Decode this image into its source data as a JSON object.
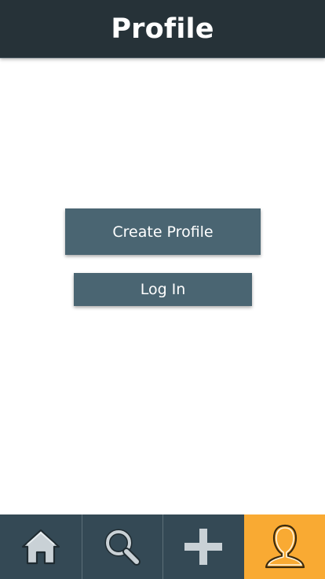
{
  "header": {
    "title": "Profile"
  },
  "actions": {
    "create_profile_label": "Create Profile",
    "log_in_label": "Log In"
  },
  "tabbar": {
    "items": [
      {
        "icon": "home-icon",
        "active": false
      },
      {
        "icon": "search-icon",
        "active": false
      },
      {
        "icon": "plus-icon",
        "active": false
      },
      {
        "icon": "user-icon",
        "active": true
      }
    ]
  },
  "colors": {
    "header_bg": "#263238",
    "button_bg": "#4a6572",
    "tabbar_bg": "#344955",
    "active_tab": "#f9aa33"
  }
}
